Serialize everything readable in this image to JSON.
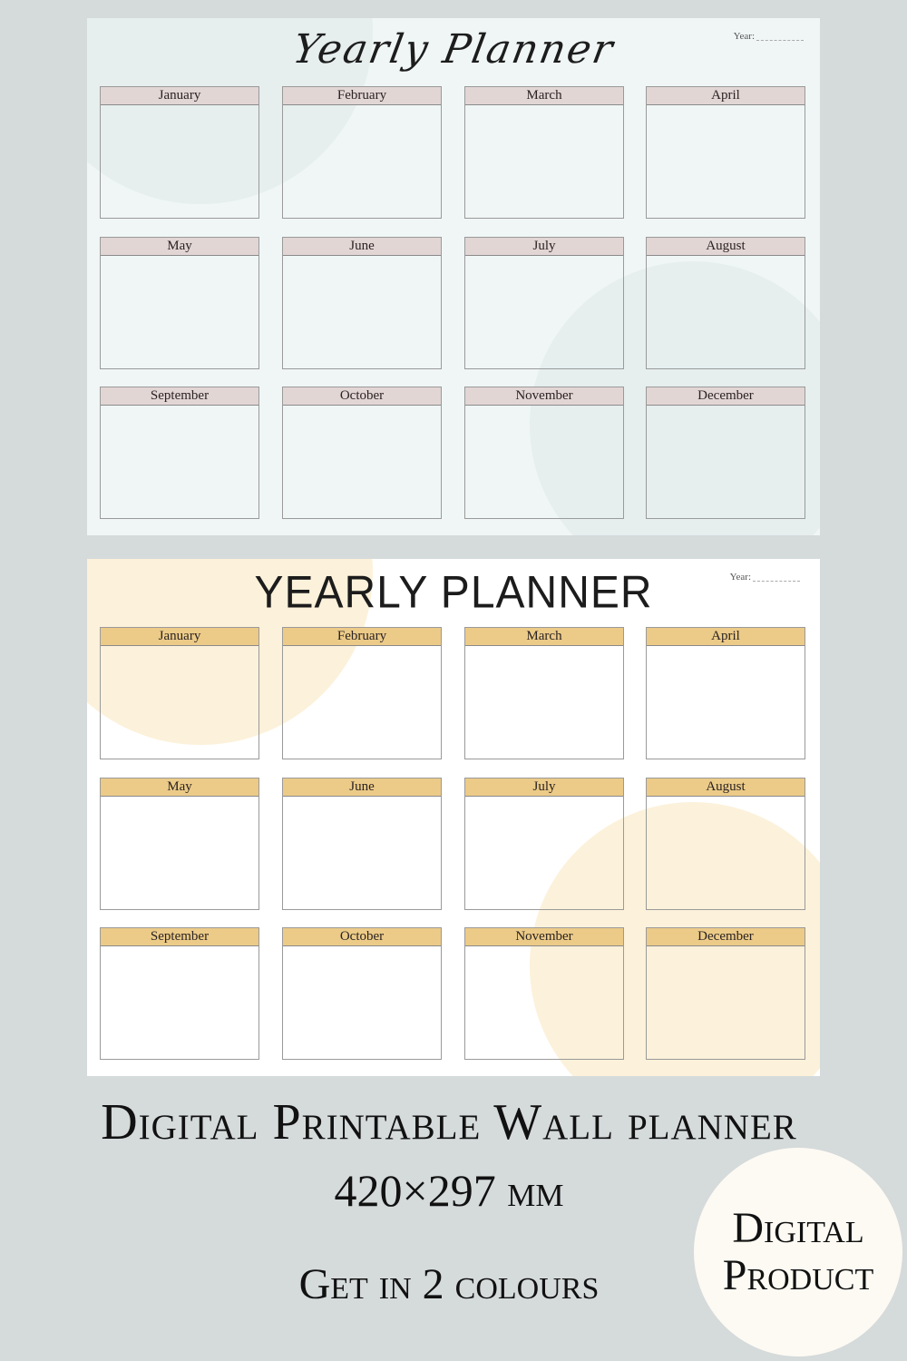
{
  "planners": [
    {
      "title": "Yearly Planner",
      "year_label": "Year:",
      "theme": {
        "header_color": "#e2d6d5",
        "background": "#f0f6f6",
        "decor_color": "#e4ecec"
      },
      "months": [
        "January",
        "February",
        "March",
        "April",
        "May",
        "June",
        "July",
        "August",
        "September",
        "October",
        "November",
        "December"
      ]
    },
    {
      "title": "YEARLY PLANNER",
      "year_label": "Year:",
      "theme": {
        "header_color": "#eccb88",
        "background": "#ffffff",
        "decor_color": "#fcefd6"
      },
      "months": [
        "January",
        "February",
        "March",
        "April",
        "May",
        "June",
        "July",
        "August",
        "September",
        "October",
        "November",
        "December"
      ]
    }
  ],
  "captions": {
    "headline": "Digital Printable Wall planner",
    "size": "420×297 mm",
    "colours": "Get in 2 colours"
  },
  "badge": {
    "line1": "Digital",
    "line2": "Product"
  },
  "page_background": "#d5dadb"
}
